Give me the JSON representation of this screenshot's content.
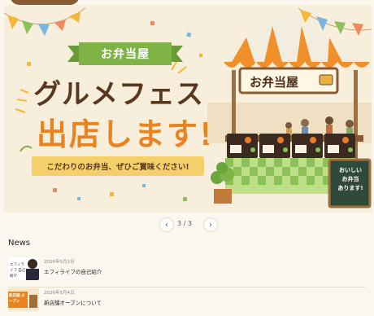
{
  "hero": {
    "ribbon": "お弁当屋",
    "title_line1": "グルメフェス",
    "title_line2": "出店します!",
    "subtitle": "こだわりのお弁当、ぜひご賞味ください!",
    "stall_sign": "お弁当屋",
    "board_text": [
      "おいしい",
      "お弁当",
      "あります!"
    ]
  },
  "carousel": {
    "prev": "‹",
    "next": "›",
    "counter": "3 / 3"
  },
  "news": {
    "heading": "News",
    "items": [
      {
        "date": "2026年5月2日",
        "title": "エフィライフの自己紹介",
        "thumb_text": "エフィライフ 自己紹介"
      },
      {
        "date": "2026年5月4日",
        "title": "新店舗オープンについて",
        "thumb_text": "新店舗 オープン"
      }
    ]
  },
  "colors": {
    "accent_orange": "#e88420",
    "brand_brown": "#5a3820",
    "ribbon_green": "#7fb247",
    "banner_yellow": "#f5d06a"
  }
}
